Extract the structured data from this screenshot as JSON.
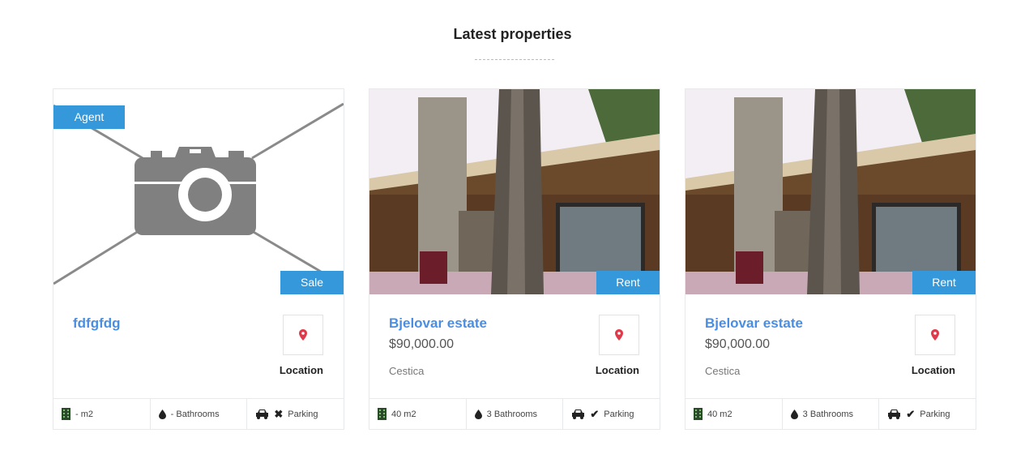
{
  "section_title": "Latest properties",
  "location_label": "Location",
  "accent": "#3498db",
  "cards": [
    {
      "name": "fdfgfdg",
      "price": "",
      "city": "",
      "agent_badge": "Agent",
      "type": "Sale",
      "area": "- m2",
      "bathrooms": "- Bathrooms",
      "parking": "Parking",
      "parking_available": false,
      "image": "placeholder"
    },
    {
      "name": "Bjelovar estate",
      "price": "$90,000.00",
      "city": "Cestica",
      "type": "Rent",
      "area": "40 m2",
      "bathrooms": "3 Bathrooms",
      "parking": "Parking",
      "parking_available": true,
      "image": "photo"
    },
    {
      "name": "Bjelovar estate",
      "price": "$90,000.00",
      "city": "Cestica",
      "type": "Rent",
      "area": "40 m2",
      "bathrooms": "3 Bathrooms",
      "parking": "Parking",
      "parking_available": true,
      "image": "photo"
    }
  ]
}
